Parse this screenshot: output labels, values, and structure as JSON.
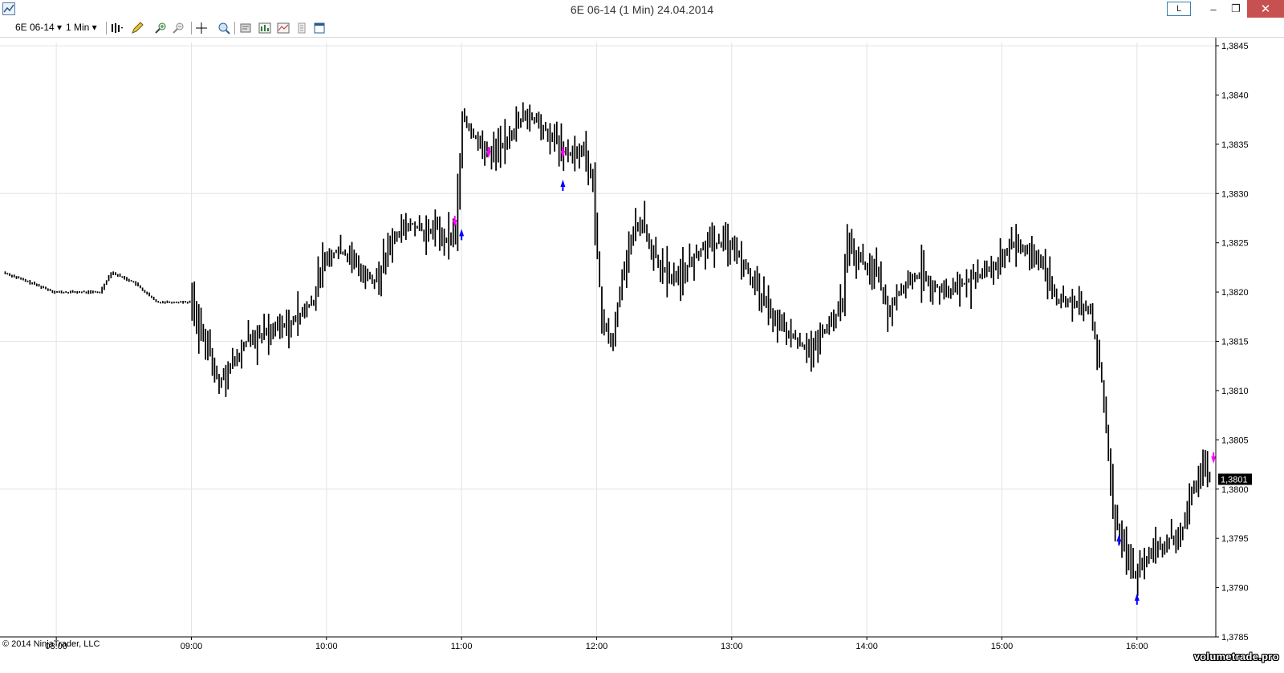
{
  "window": {
    "title": "6E 06-14 (1 Min)  24.04.2014",
    "link_button": "L",
    "minimize": "–",
    "maximize": "❐",
    "close": "✕"
  },
  "toolbar": {
    "instrument": "6E 06-14",
    "interval": "1 Min",
    "icons": [
      "bar-style-icon",
      "drawing-pencil-icon",
      "zoom-in-icon",
      "zoom-out-icon",
      "crosshair-icon",
      "data-box-icon",
      "properties-icon",
      "strategies-icon",
      "indicators-icon",
      "chart-trader-icon",
      "workspace-icon"
    ]
  },
  "footer": {
    "copyright": "© 2014 NinjaTrader, LLC",
    "watermark": "volumetrade.pro"
  },
  "chart_data": {
    "type": "bar",
    "instrument": "6E 06-14",
    "interval": "1 Min",
    "date": "24.04.2014",
    "x_ticks": [
      "08:00",
      "09:00",
      "10:00",
      "11:00",
      "12:00",
      "13:00",
      "14:00",
      "15:00",
      "16:00"
    ],
    "x_range": [
      "07:35",
      "16:35"
    ],
    "y_ticks": [
      "1,3785",
      "1,3790",
      "1,3795",
      "1,3800",
      "1,3805",
      "1,3810",
      "1,3815",
      "1,3820",
      "1,3825",
      "1,3830",
      "1,3835",
      "1,3840",
      "1,3845"
    ],
    "ylim": [
      1.3785,
      1.3845
    ],
    "grid": true,
    "last_price": "1,3801",
    "colors": {
      "bars": "#000000",
      "grid": "#e4e4e4",
      "buy_marker": "#0000ff",
      "sell_marker": "#ff00ff",
      "price_label_bg": "#000000"
    },
    "price_path": [
      [
        "07:37",
        1.3822
      ],
      [
        "08:00",
        1.382
      ],
      [
        "08:20",
        1.382
      ],
      [
        "08:25",
        1.3822
      ],
      [
        "08:35",
        1.3821
      ],
      [
        "08:45",
        1.3819
      ],
      [
        "09:00",
        1.3819
      ],
      [
        "09:05",
        1.3816
      ],
      [
        "09:10",
        1.3813
      ],
      [
        "09:13",
        1.3811
      ],
      [
        "09:20",
        1.3813
      ],
      [
        "09:25",
        1.3815
      ],
      [
        "09:35",
        1.3816
      ],
      [
        "09:45",
        1.3817
      ],
      [
        "09:55",
        1.3819
      ],
      [
        "10:00",
        1.3824
      ],
      [
        "10:08",
        1.3824
      ],
      [
        "10:18",
        1.3822
      ],
      [
        "10:22",
        1.3821
      ],
      [
        "10:30",
        1.3825
      ],
      [
        "10:38",
        1.3827
      ],
      [
        "10:45",
        1.3826
      ],
      [
        "10:50",
        1.3827
      ],
      [
        "10:52",
        1.3825
      ],
      [
        "10:58",
        1.3826
      ],
      [
        "11:01",
        1.3838
      ],
      [
        "11:05",
        1.3836
      ],
      [
        "11:15",
        1.3834
      ],
      [
        "11:22",
        1.3836
      ],
      [
        "11:30",
        1.3838
      ],
      [
        "11:40",
        1.3836
      ],
      [
        "11:48",
        1.3834
      ],
      [
        "11:55",
        1.3834
      ],
      [
        "11:59",
        1.3831
      ],
      [
        "12:03",
        1.3817
      ],
      [
        "12:08",
        1.3815
      ],
      [
        "12:12",
        1.3822
      ],
      [
        "12:17",
        1.3826
      ],
      [
        "12:20",
        1.3827
      ],
      [
        "12:28",
        1.3823
      ],
      [
        "12:35",
        1.3821
      ],
      [
        "12:42",
        1.3823
      ],
      [
        "12:50",
        1.3825
      ],
      [
        "13:00",
        1.3825
      ],
      [
        "13:08",
        1.3822
      ],
      [
        "13:15",
        1.3819
      ],
      [
        "13:25",
        1.3816
      ],
      [
        "13:35",
        1.3814
      ],
      [
        "13:45",
        1.3817
      ],
      [
        "13:50",
        1.3819
      ],
      [
        "13:52",
        1.3825
      ],
      [
        "13:58",
        1.3823
      ],
      [
        "14:05",
        1.3822
      ],
      [
        "14:10",
        1.3818
      ],
      [
        "14:15",
        1.382
      ],
      [
        "14:25",
        1.3822
      ],
      [
        "14:35",
        1.382
      ],
      [
        "14:45",
        1.3821
      ],
      [
        "15:00",
        1.3823
      ],
      [
        "15:05",
        1.3825
      ],
      [
        "15:15",
        1.3824
      ],
      [
        "15:20",
        1.3822
      ],
      [
        "15:25",
        1.3819
      ],
      [
        "15:35",
        1.3819
      ],
      [
        "15:40",
        1.3818
      ],
      [
        "15:45",
        1.3811
      ],
      [
        "15:50",
        1.3798
      ],
      [
        "15:55",
        1.3794
      ],
      [
        "16:00",
        1.3791
      ],
      [
        "16:05",
        1.3793
      ],
      [
        "16:10",
        1.3794
      ],
      [
        "16:15",
        1.3795
      ],
      [
        "16:20",
        1.3795
      ],
      [
        "16:25",
        1.38
      ],
      [
        "16:30",
        1.3802
      ],
      [
        "16:32",
        1.3801
      ]
    ],
    "markers": [
      {
        "time": "10:57",
        "price": 1.3827,
        "side": "sell"
      },
      {
        "time": "11:00",
        "price": 1.3826,
        "side": "buy"
      },
      {
        "time": "11:12",
        "price": 1.3834,
        "side": "sell"
      },
      {
        "time": "11:45",
        "price": 1.3834,
        "side": "sell"
      },
      {
        "time": "11:45",
        "price": 1.3831,
        "side": "buy"
      },
      {
        "time": "15:52",
        "price": 1.3795,
        "side": "buy"
      },
      {
        "time": "16:00",
        "price": 1.3789,
        "side": "buy"
      },
      {
        "time": "16:34",
        "price": 1.3803,
        "side": "sell"
      }
    ]
  }
}
